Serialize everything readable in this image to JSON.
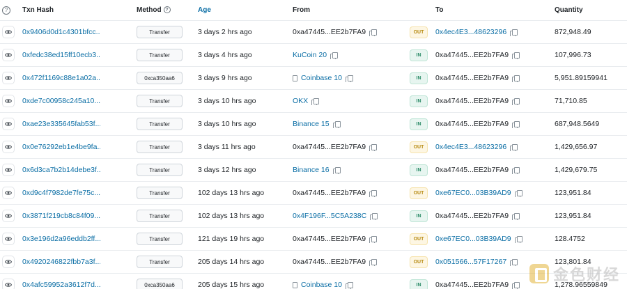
{
  "header": {
    "help": "?",
    "txn_hash": "Txn Hash",
    "method": "Method",
    "age": "Age",
    "from": "From",
    "to": "To",
    "quantity": "Quantity"
  },
  "colors": {
    "link": "#0b6ea5",
    "out": "#b68a10",
    "in": "#2a8a66"
  },
  "rows": [
    {
      "hash": "0x9406d0d1c4301bfcc...",
      "method": "Transfer",
      "age": "3 days 2 hrs ago",
      "from": "0xa47445...EE2b7FA9",
      "from_link": false,
      "from_doc": false,
      "dir": "OUT",
      "to": "0x4ec4E3...48623296",
      "to_link": true,
      "qty": "872,948.49"
    },
    {
      "hash": "0xfedc38ed15ff10ecb3...",
      "method": "Transfer",
      "age": "3 days 4 hrs ago",
      "from": "KuCoin 20",
      "from_link": true,
      "from_doc": false,
      "dir": "IN",
      "to": "0xa47445...EE2b7FA9",
      "to_link": false,
      "qty": "107,996.73"
    },
    {
      "hash": "0x472f1169c88e1a02a...",
      "method": "0xca350aa6",
      "age": "3 days 9 hrs ago",
      "from": "Coinbase 10",
      "from_link": true,
      "from_doc": true,
      "dir": "IN",
      "to": "0xa47445...EE2b7FA9",
      "to_link": false,
      "qty": "5,951.89159941"
    },
    {
      "hash": "0xde7c00958c245a10...",
      "method": "Transfer",
      "age": "3 days 10 hrs ago",
      "from": "OKX",
      "from_link": true,
      "from_doc": false,
      "dir": "IN",
      "to": "0xa47445...EE2b7FA9",
      "to_link": false,
      "qty": "71,710.85"
    },
    {
      "hash": "0xae23e335645fab53f...",
      "method": "Transfer",
      "age": "3 days 10 hrs ago",
      "from": "Binance 15",
      "from_link": true,
      "from_doc": false,
      "dir": "IN",
      "to": "0xa47445...EE2b7FA9",
      "to_link": false,
      "qty": "687,948.5649"
    },
    {
      "hash": "0x0e76292eb1e4be9fa...",
      "method": "Transfer",
      "age": "3 days 11 hrs ago",
      "from": "0xa47445...EE2b7FA9",
      "from_link": false,
      "from_doc": false,
      "dir": "OUT",
      "to": "0x4ec4E3...48623296",
      "to_link": true,
      "qty": "1,429,656.97"
    },
    {
      "hash": "0x6d3ca7b2b14debe3f...",
      "method": "Transfer",
      "age": "3 days 12 hrs ago",
      "from": "Binance 16",
      "from_link": true,
      "from_doc": false,
      "dir": "IN",
      "to": "0xa47445...EE2b7FA9",
      "to_link": false,
      "qty": "1,429,679.75"
    },
    {
      "hash": "0xd9c4f7982de7fe75c...",
      "method": "Transfer",
      "age": "102 days 13 hrs ago",
      "from": "0xa47445...EE2b7FA9",
      "from_link": false,
      "from_doc": false,
      "dir": "OUT",
      "to": "0xe67EC0...03B39AD9",
      "to_link": true,
      "qty": "123,951.84"
    },
    {
      "hash": "0x3871f219cb8c84f09...",
      "method": "Transfer",
      "age": "102 days 13 hrs ago",
      "from": "0x4F196F...5C5A238C",
      "from_link": true,
      "from_doc": false,
      "dir": "IN",
      "to": "0xa47445...EE2b7FA9",
      "to_link": false,
      "qty": "123,951.84"
    },
    {
      "hash": "0x3e196d2a96eddb2ff...",
      "method": "Transfer",
      "age": "121 days 19 hrs ago",
      "from": "0xa47445...EE2b7FA9",
      "from_link": false,
      "from_doc": false,
      "dir": "OUT",
      "to": "0xe67EC0...03B39AD9",
      "to_link": true,
      "qty": "128.4752"
    },
    {
      "hash": "0x4920246822fbb7a3f...",
      "method": "Transfer",
      "age": "205 days 14 hrs ago",
      "from": "0xa47445...EE2b7FA9",
      "from_link": false,
      "from_doc": false,
      "dir": "OUT",
      "to": "0x051566...57F17267",
      "to_link": true,
      "qty": "123,801.84"
    },
    {
      "hash": "0x4afc59952a3612f7d...",
      "method": "0xca350aa6",
      "age": "205 days 15 hrs ago",
      "from": "Coinbase 10",
      "from_link": true,
      "from_doc": true,
      "dir": "IN",
      "to": "0xa47445...EE2b7FA9",
      "to_link": false,
      "qty": "1,278.96559849"
    }
  ],
  "watermark": {
    "text": "金色财经",
    "icon": "jinse-logo-icon"
  }
}
